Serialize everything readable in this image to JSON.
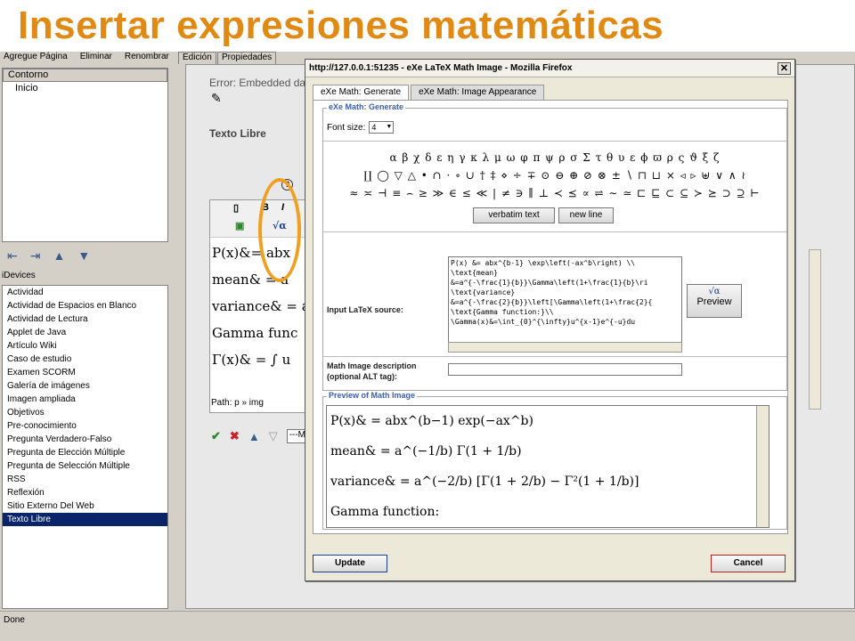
{
  "slide": {
    "title": "Insertar expresiones matemáticas"
  },
  "left": {
    "tabs": [
      "Agregue Página",
      "Eliminar",
      "Renombrar"
    ],
    "tree_header": "Contorno",
    "tree_node": "Inicio",
    "idevices_label": "iDevices",
    "idevices": [
      "Actividad",
      "Actividad de Espacios en Blanco",
      "Actividad de Lectura",
      "Applet de Java",
      "Artículo Wiki",
      "Caso de estudio",
      "Examen SCORM",
      "Galería de imágenes",
      "Imagen ampliada",
      "Objetivos",
      "Pre-conocimiento",
      "Pregunta Verdadero-Falso",
      "Pregunta de Elección Múltiple",
      "Pregunta de Selección Múltiple",
      "RSS",
      "Reflexión",
      "Sitio Externo Del Web",
      "Texto Libre"
    ],
    "selected": "Texto Libre"
  },
  "right": {
    "tabs": [
      "Edición",
      "Propiedades"
    ],
    "error_text": "Error: Embedded da",
    "texto_libre_label": "Texto Libre",
    "editor_lines": [
      "P(x)&= abx",
      "mean& = a",
      "variance& = a",
      "Gamma func",
      "Γ(x)& = ∫ u"
    ],
    "path": "Path: p » img",
    "select_value": "---M"
  },
  "status": {
    "text": "Done"
  },
  "modal": {
    "title": "http://127.0.0.1:51235 - eXe LaTeX Math Image - Mozilla Firefox",
    "close": "✕",
    "tabs": [
      "eXe Math: Generate",
      "eXe Math: Image Appearance"
    ],
    "generate_legend": "eXe Math: Generate",
    "font_size_label": "Font size:",
    "font_size_value": "4",
    "symbols_row1": "α β χ δ ε η γ κ λ μ ω φ π ψ ρ σ Σ τ θ υ ε ϕ ϖ ρ ς ϑ ξ ζ",
    "symbols_row2": "∐ ◯ ▽ △ • ∩ · ∘ ∪ † ‡ ⋄ ÷ ∓ ⊙ ⊖ ⊕ ⊘ ⊗ ± ∖ ⊓ ⊔ × ◃ ▹ ⊎ ∨ ∧ ≀",
    "symbols_row3": "≈ ≍ ⊣ ≡ ⌢ ≥ ≫ ∈ ≤ ≪ | ≠ ∋ ∥ ⊥ ≺ ⪯ ∝ ⇌ ∼ ≃ ⊏ ⊑ ⊂ ⊆ ≻ ⪰ ⊃ ⊇ ⊢",
    "verbatim_button": "verbatim text",
    "newline_button": "new line",
    "latex_label": "Input LaTeX source:",
    "latex_source": "P(x) &= abx^{b-1} \\exp\\left(-ax^b\\right) \\\\\n\\text{mean}\n&=a^{-\\frac{1}{b}}\\Gamma\\left(1+\\frac{1}{b}\\ri\n\\text{variance}\n&=a^{-\\frac{2}{b}}\\left[\\Gamma\\left(1+\\frac{2}{\n\\text{Gamma function:}\\\\\n\\Gamma(x)&=\\int_{0}^{\\infty}u^{x-1}e^{-u}du",
    "preview_button": "Preview",
    "alt_label_1": "Math Image description",
    "alt_label_2": "(optional ALT tag):",
    "alt_value": "",
    "preview_legend": "Preview of Math Image",
    "preview_lines": [
      "P(x)& = abx^(b−1) exp(−ax^b)",
      "mean& = a^(−1/b) Γ(1 + 1/b)",
      "variance& = a^(−2/b) [Γ(1 + 2/b) − Γ²(1 + 1/b)]",
      "Gamma function:",
      "∞"
    ],
    "update_button": "Update",
    "cancel_button": "Cancel"
  },
  "colors": {
    "title": "#e08a14",
    "highlight": "#f0a020",
    "selection": "#0a246a"
  }
}
